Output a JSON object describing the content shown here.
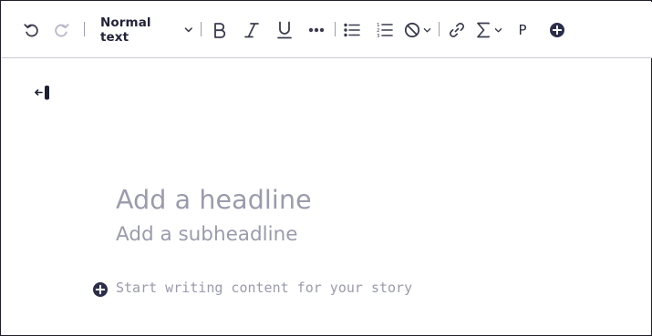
{
  "toolbar": {
    "undo_icon": "undo-icon",
    "redo_icon": "redo-icon",
    "text_style": "Normal text",
    "bold_icon": "bold-icon",
    "italic_icon": "italic-icon",
    "underline_icon": "underline-icon",
    "more_icon": "more-formatting-icon",
    "bullet_list_icon": "bullet-list-icon",
    "numbered_list_icon": "numbered-list-icon",
    "clear_format_icon": "clear-formatting-icon",
    "link_icon": "link-icon",
    "sigma_icon": "sigma-icon",
    "paragraph_label": "P",
    "insert_icon": "insert-plus-icon"
  },
  "editor": {
    "headline_placeholder": "Add a headline",
    "subheadline_placeholder": "Add a subheadline",
    "content_placeholder": "Start writing content for your story",
    "add_block_icon": "plus-circle-icon",
    "cursor_icon": "text-cursor-marker-icon"
  },
  "colors": {
    "toolbar_icon": "#3a3b4d",
    "placeholder": "#9a9bac",
    "divider": "#c9c9d6",
    "accent_dark": "#2b2e4a"
  }
}
